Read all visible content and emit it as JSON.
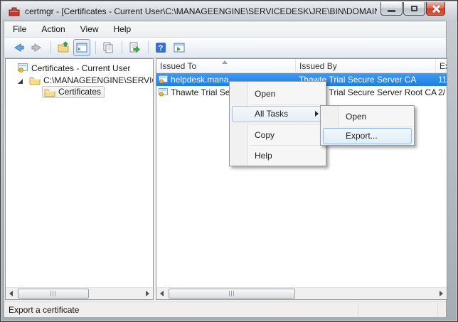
{
  "window": {
    "title": "certmgr - [Certificates - Current User\\C:\\MANAGEENGINE\\SERVICEDESK\\JRE\\BIN\\DOMAIN.P..."
  },
  "menu_bar": {
    "items": [
      {
        "label": "File"
      },
      {
        "label": "Action"
      },
      {
        "label": "View"
      },
      {
        "label": "Help"
      }
    ]
  },
  "toolbar": {
    "icons": [
      "back-icon",
      "forward-icon",
      "up-one-level-icon",
      "show-console-tree-icon",
      "copy-icon",
      "export-list-icon",
      "help-icon",
      "new-window-icon"
    ],
    "pressed_icon": "show-console-tree-icon"
  },
  "tree": {
    "items": [
      {
        "label": "Certificates - Current User",
        "level": 0,
        "icon": "certificate-store-icon"
      },
      {
        "label": "C:\\MANAGEENGINE\\SERVICE",
        "level": 1,
        "icon": "folder-icon",
        "expanded": true
      },
      {
        "label": "Certificates",
        "level": 2,
        "icon": "folder-icon",
        "selected": true
      }
    ]
  },
  "list": {
    "columns": [
      {
        "label": "Issued To",
        "sort": "asc"
      },
      {
        "label": "Issued By",
        "sort": null
      },
      {
        "label": "Ex",
        "sort": null
      }
    ],
    "rows": [
      {
        "issued_to": "helpdesk.mana",
        "issued_by": "Thawte Trial Secure Server CA",
        "expires": "11",
        "selected": true
      },
      {
        "issued_to": "Thawte Trial Se",
        "issued_by": "Thawte Trial Secure Server Root CA",
        "expires": "2/",
        "selected": false
      }
    ]
  },
  "context_menu": {
    "items": [
      {
        "label": "Open",
        "has_submenu": false,
        "highlighted": false
      },
      {
        "label": "All Tasks",
        "has_submenu": true,
        "highlighted": true
      },
      {
        "label": "Copy",
        "has_submenu": false,
        "highlighted": false
      },
      {
        "label": "Help",
        "has_submenu": false,
        "highlighted": false
      }
    ]
  },
  "submenu": {
    "items": [
      {
        "label": "Open",
        "highlighted": false
      },
      {
        "label": "Export...",
        "highlighted": true
      }
    ]
  },
  "status_bar": {
    "text": "Export a certificate"
  },
  "colors": {
    "selection_blue": "#2f8fee",
    "close_button_red": "#c64430",
    "menu_highlight_border": "#8fb6de",
    "titlebar_gray": "#d6dadf"
  }
}
